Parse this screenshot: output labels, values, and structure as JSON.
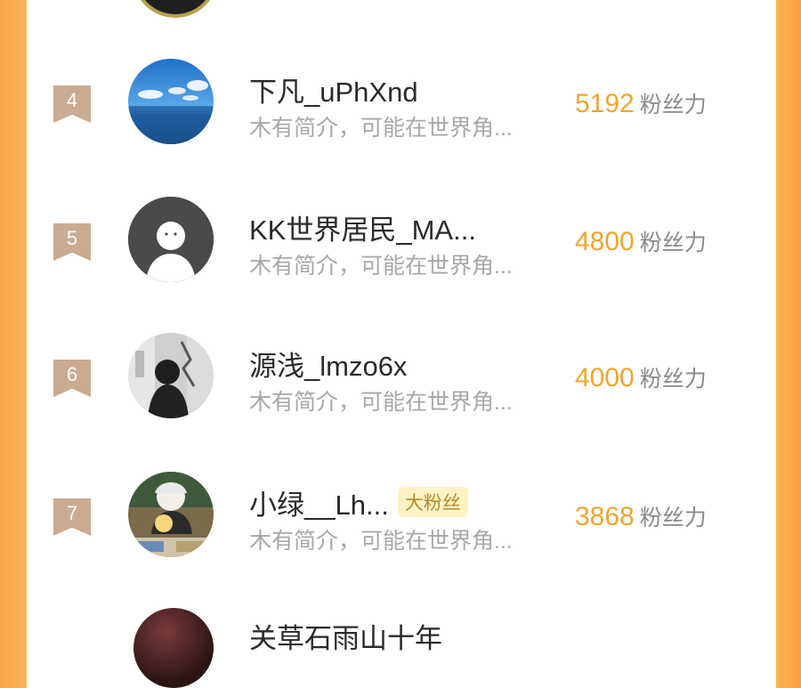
{
  "ranking": {
    "unit_label": "粉丝力",
    "rows": [
      {
        "rank": "4",
        "name": "下凡_uPhXnd",
        "intro": "木有简介，可能在世界角...",
        "score": "5192",
        "avatar": "ocean-sky-avatar",
        "tag": ""
      },
      {
        "rank": "5",
        "name": "KK世界居民_MA...",
        "intro": "木有简介，可能在世界角...",
        "score": "4800",
        "avatar": "default-avatar",
        "tag": ""
      },
      {
        "rank": "6",
        "name": "源浅_lmzo6x",
        "intro": "木有简介，可能在世界角...",
        "score": "4000",
        "avatar": "grayscale-photo-avatar",
        "tag": ""
      },
      {
        "rank": "7",
        "name": "小绿__Lh...",
        "intro": "木有简介，可能在世界角...",
        "score": "3868",
        "avatar": "anime-avatar",
        "tag": "大粉丝"
      }
    ],
    "next_row_partial_name": "关草石雨山十年"
  },
  "colors": {
    "accent_orange": "#f0a530",
    "badge_tan": "#c9ab93",
    "frame_orange": "#fbb454",
    "tag_bg": "#fdf3c5"
  }
}
